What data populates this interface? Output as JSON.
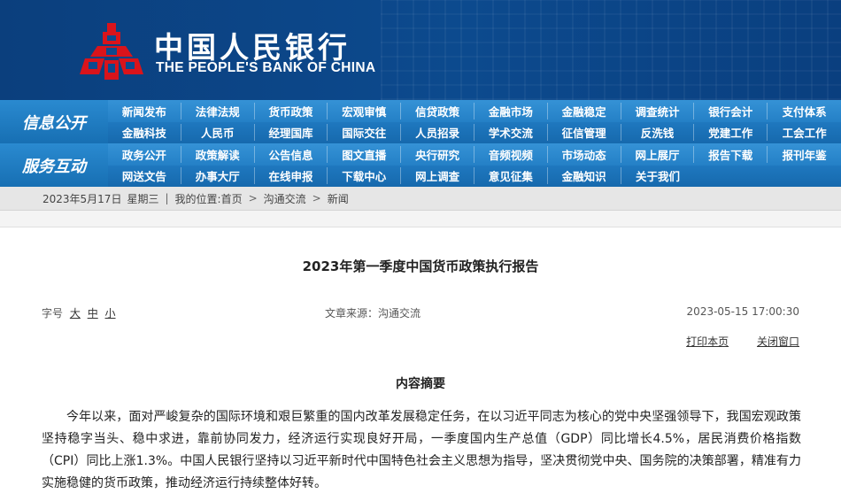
{
  "header": {
    "title_cn": "中国人民银行",
    "title_en": "THE PEOPLE'S BANK OF CHINA",
    "colors": {
      "logo_red": "#d9141b",
      "header_blue": "#0c4a8e"
    }
  },
  "nav": {
    "section1_label": "信息公开",
    "section2_label": "服务互动",
    "rows": [
      [
        "新闻发布",
        "法律法规",
        "货币政策",
        "宏观审慎",
        "信贷政策",
        "金融市场",
        "金融稳定",
        "调查统计",
        "银行会计",
        "支付体系"
      ],
      [
        "金融科技",
        "人民币",
        "经理国库",
        "国际交往",
        "人员招录",
        "学术交流",
        "征信管理",
        "反洗钱",
        "党建工作",
        "工会工作"
      ],
      [
        "政务公开",
        "政策解读",
        "公告信息",
        "图文直播",
        "央行研究",
        "音频视频",
        "市场动态",
        "网上展厅",
        "报告下载",
        "报刊年鉴"
      ],
      [
        "网送文告",
        "办事大厅",
        "在线申报",
        "下载中心",
        "网上调查",
        "意见征集",
        "金融知识",
        "关于我们"
      ]
    ]
  },
  "breadcrumb": {
    "date": "2023年5月17日",
    "weekday": "星期三",
    "location_label": "我的位置:",
    "home": "首页",
    "level1": "沟通交流",
    "level2": "新闻",
    "separator": "|",
    "arrow": ">"
  },
  "article": {
    "title": "2023年第一季度中国货币政策执行报告",
    "font_size_label": "字号",
    "size_large": "大",
    "size_medium": "中",
    "size_small": "小",
    "source": "文章来源：沟通交流",
    "datetime": "2023-05-15 17:00:30",
    "print_label": "打印本页",
    "close_label": "关闭窗口",
    "section_heading": "内容摘要",
    "paragraph": "今年以来，面对严峻复杂的国际环境和艰巨繁重的国内改革发展稳定任务，在以习近平同志为核心的党中央坚强领导下，我国宏观政策坚持稳字当头、稳中求进，靠前协同发力，经济运行实现良好开局，一季度国内生产总值（GDP）同比增长4.5%，居民消费价格指数（CPI）同比上涨1.3%。中国人民银行坚持以习近平新时代中国特色社会主义思想为指导，坚决贯彻党中央、国务院的决策部署，精准有力实施稳健的货币政策，推动经济运行持续整体好转。"
  }
}
